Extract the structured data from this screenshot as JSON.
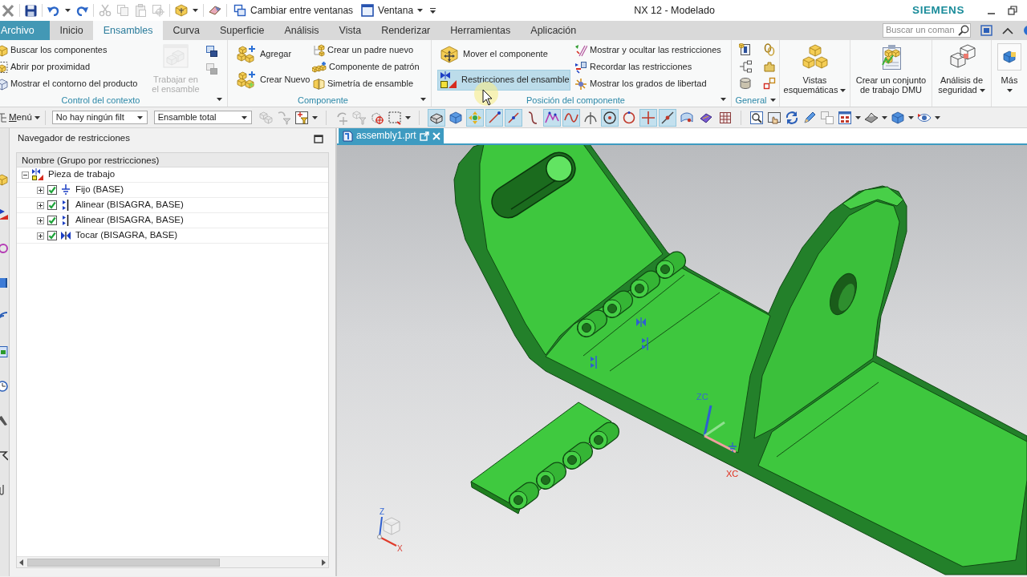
{
  "window": {
    "title": "NX 12 - Modelado",
    "brand": "SIEMENS"
  },
  "quick_access": {
    "switch_windows": "Cambiar entre ventanas",
    "window_menu": "Ventana"
  },
  "tabs": [
    {
      "label": "Archivo",
      "kind": "file",
      "selected": false
    },
    {
      "label": "Inicio",
      "kind": "tab",
      "selected": false
    },
    {
      "label": "Ensambles",
      "kind": "tab",
      "selected": true
    },
    {
      "label": "Curva",
      "kind": "tab",
      "selected": false
    },
    {
      "label": "Superficie",
      "kind": "tab",
      "selected": false
    },
    {
      "label": "Análisis",
      "kind": "tab",
      "selected": false
    },
    {
      "label": "Vista",
      "kind": "tab",
      "selected": false
    },
    {
      "label": "Renderizar",
      "kind": "tab",
      "selected": false
    },
    {
      "label": "Herramientas",
      "kind": "tab",
      "selected": false
    },
    {
      "label": "Aplicación",
      "kind": "tab",
      "selected": false
    }
  ],
  "command_search": {
    "placeholder": "Buscar un coman"
  },
  "ribbon": {
    "groups": [
      {
        "kind": "columns",
        "label": "Control del contexto",
        "columns": [
          {
            "kind": "small",
            "items": [
              {
                "label": "Buscar los componentes"
              },
              {
                "label": "Abrir por proximidad"
              },
              {
                "label": "Mostrar el contorno del producto"
              }
            ]
          },
          {
            "kind": "large",
            "items": [
              {
                "label": "Trabajar en el ensamble",
                "disabled": true
              }
            ]
          },
          {
            "kind": "icons",
            "items": [
              {
                "disabled": false
              },
              {
                "disabled": true
              }
            ]
          }
        ]
      },
      {
        "kind": "columns",
        "label": "Componente",
        "columns": [
          {
            "kind": "medium",
            "items": [
              {
                "label": "Agregar"
              },
              {
                "label": "Crear Nuevo"
              }
            ]
          },
          {
            "kind": "small",
            "items": [
              {
                "label": "Crear un padre nuevo"
              },
              {
                "label": "Componente de patrón"
              },
              {
                "label": "Simetría de ensamble"
              }
            ]
          }
        ]
      },
      {
        "kind": "columns",
        "label": "Posición del componente",
        "columns": [
          {
            "kind": "medium",
            "items": [
              {
                "label": "Mover el componente",
                "highlighted": false
              },
              {
                "label": "Restricciones del ensamble",
                "highlighted": true
              }
            ]
          },
          {
            "kind": "small",
            "items": [
              {
                "label": "Mostrar y ocultar las restricciones"
              },
              {
                "label": "Recordar las restricciones"
              },
              {
                "label": "Mostrar los grados de libertad"
              }
            ]
          }
        ]
      },
      {
        "kind": "icons",
        "label": "General"
      },
      {
        "kind": "button",
        "label": "Vistas esquemáticas",
        "dropdown": true
      },
      {
        "kind": "button",
        "label": "Crear un conjunto de trabajo DMU",
        "dropdown": false
      },
      {
        "kind": "button",
        "label": "Análisis de seguridad",
        "dropdown": true
      },
      {
        "kind": "more",
        "label": "Más",
        "dropdown": true
      }
    ]
  },
  "toolbar": {
    "menu": "Menú",
    "selection_filter": "No hay ningún filt",
    "scope": "Ensamble total",
    "toggles": [
      {
        "on": true
      },
      {
        "on": false
      },
      {
        "on": true
      },
      {
        "on": true
      },
      {
        "on": true
      },
      {
        "on": false
      },
      {
        "on": true
      },
      {
        "on": true
      },
      {
        "on": false
      },
      {
        "on": true
      },
      {
        "on": false
      },
      {
        "on": true
      },
      {
        "on": true
      },
      {
        "on": false
      },
      {
        "on": false
      },
      {
        "on": false
      }
    ]
  },
  "navigator": {
    "title": "Navegador de restricciones",
    "column": "Nombre (Grupo por restricciones)",
    "tree": [
      {
        "label": "Pieza de trabajo",
        "kind": "group",
        "expanded": true,
        "children": [
          {
            "label": "Fijo (BASE)",
            "kind": "fix",
            "checked": true,
            "expanded": false
          },
          {
            "label": "Alinear (BISAGRA, BASE)",
            "kind": "align",
            "checked": true,
            "expanded": false
          },
          {
            "label": "Alinear (BISAGRA, BASE)",
            "kind": "align",
            "checked": true,
            "expanded": false
          },
          {
            "label": "Tocar (BISAGRA, BASE)",
            "kind": "touch",
            "checked": true,
            "expanded": false
          }
        ]
      }
    ]
  },
  "graphics": {
    "tab": "assembly1.prt",
    "wcs_labels": {
      "z": "ZC",
      "x": "XC"
    },
    "view_triad_labels": {
      "z": "Z",
      "x": "X"
    }
  }
}
